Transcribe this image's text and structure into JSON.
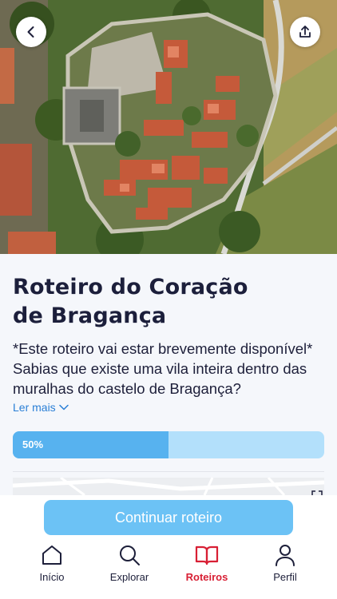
{
  "header": {
    "back_icon": "chevron-left-icon",
    "share_icon": "share-icon",
    "hero_image": "aerial-view-braganca-castle"
  },
  "route": {
    "title_line1": "Roteiro do Coração",
    "title_line2": "de Bragança",
    "description_line1": "*Este roteiro vai estar brevemente disponível*",
    "description_line2": "Sabias que existe uma vila inteira dentro das muralhas do castelo de Bragança?",
    "read_more": "Ler mais",
    "progress": {
      "value": 0.5,
      "label": "50%"
    },
    "map_icon": "expand-icon"
  },
  "cta": {
    "label": "Continuar roteiro"
  },
  "tabbar": {
    "items": [
      {
        "label": "Início",
        "icon": "home-icon",
        "active": false
      },
      {
        "label": "Explorar",
        "icon": "search-icon",
        "active": false
      },
      {
        "label": "Roteiros",
        "icon": "book-icon",
        "active": true
      },
      {
        "label": "Perfil",
        "icon": "user-icon",
        "active": false
      }
    ]
  },
  "colors": {
    "accent": "#57b2ef",
    "progress_track": "#b3e0fb",
    "active_tab": "#d81f34",
    "link": "#2a7fd6",
    "title": "#1c1f3b"
  }
}
